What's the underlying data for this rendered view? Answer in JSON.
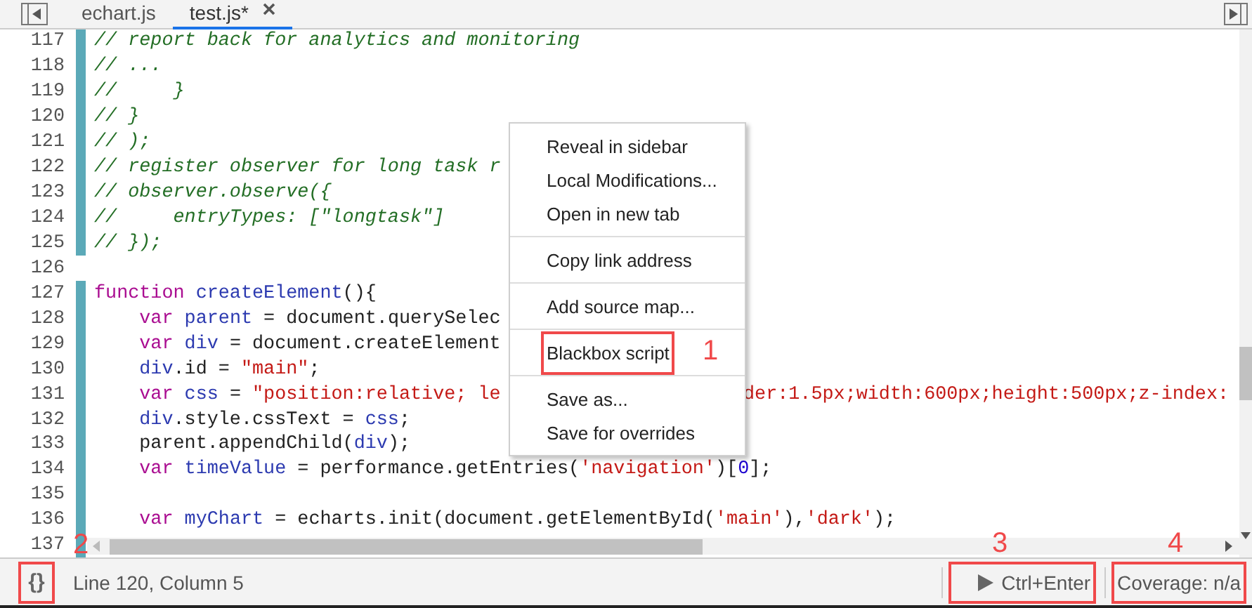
{
  "tabs": [
    {
      "label": "echart.js",
      "selected": false,
      "closable": false
    },
    {
      "label": "test.js*",
      "selected": true,
      "closable": true
    }
  ],
  "editor": {
    "lines": [
      {
        "number": "117",
        "changed": true,
        "tokens": [
          {
            "kind": "comment",
            "text": "// report back for analytics and monitoring"
          }
        ]
      },
      {
        "number": "118",
        "changed": true,
        "tokens": [
          {
            "kind": "comment",
            "text": "// ..."
          }
        ]
      },
      {
        "number": "119",
        "changed": true,
        "tokens": [
          {
            "kind": "comment",
            "text": "//     }"
          }
        ]
      },
      {
        "number": "120",
        "changed": true,
        "tokens": [
          {
            "kind": "comment",
            "text": "// }"
          }
        ]
      },
      {
        "number": "121",
        "changed": true,
        "tokens": [
          {
            "kind": "comment",
            "text": "// );"
          }
        ]
      },
      {
        "number": "122",
        "changed": true,
        "tokens": [
          {
            "kind": "comment",
            "text": "// register observer for long task r"
          }
        ]
      },
      {
        "number": "123",
        "changed": true,
        "tokens": [
          {
            "kind": "comment",
            "text": "// observer.observe({"
          }
        ]
      },
      {
        "number": "124",
        "changed": true,
        "tokens": [
          {
            "kind": "comment",
            "text": "//     entryTypes: [\"longtask\"]"
          }
        ]
      },
      {
        "number": "125",
        "changed": true,
        "tokens": [
          {
            "kind": "comment",
            "text": "// });"
          }
        ]
      },
      {
        "number": "126",
        "changed": false
      },
      {
        "number": "127",
        "changed": true,
        "tokens": [
          {
            "kind": "keyword",
            "text": "function "
          },
          {
            "kind": "def",
            "text": "createElement"
          },
          {
            "kind": "plain",
            "text": "(){"
          }
        ]
      },
      {
        "number": "128",
        "changed": true,
        "tokens": [
          {
            "kind": "keyword",
            "text": "    var "
          },
          {
            "kind": "def",
            "text": "parent"
          },
          {
            "kind": "plain",
            "text": " = document.querySelec"
          }
        ]
      },
      {
        "number": "129",
        "changed": true,
        "tokens": [
          {
            "kind": "keyword",
            "text": "    var "
          },
          {
            "kind": "def",
            "text": "div"
          },
          {
            "kind": "plain",
            "text": " = document.createElement"
          }
        ]
      },
      {
        "number": "130",
        "changed": true,
        "tokens": [
          {
            "kind": "def",
            "text": "    div"
          },
          {
            "kind": "plain",
            "text": ".id = "
          },
          {
            "kind": "string",
            "text": "\"main\""
          },
          {
            "kind": "plain",
            "text": ";"
          }
        ]
      },
      {
        "number": "131",
        "changed": true,
        "tokens": [
          {
            "kind": "keyword",
            "text": "    var "
          },
          {
            "kind": "def",
            "text": "css"
          },
          {
            "kind": "plain",
            "text": " = "
          },
          {
            "kind": "string",
            "text": "\"position:relative; le"
          }
        ],
        "tail": [
          {
            "kind": "string",
            "text": "der:1.5px;width:600px;height:500px;z-index:"
          }
        ]
      },
      {
        "number": "132",
        "changed": true,
        "tokens": [
          {
            "kind": "def",
            "text": "    div"
          },
          {
            "kind": "plain",
            "text": ".style.cssText = "
          },
          {
            "kind": "def",
            "text": "css"
          },
          {
            "kind": "plain",
            "text": ";"
          }
        ]
      },
      {
        "number": "133",
        "changed": true,
        "tokens": [
          {
            "kind": "plain",
            "text": "    parent.appendChild("
          },
          {
            "kind": "def",
            "text": "div"
          },
          {
            "kind": "plain",
            "text": ");"
          }
        ]
      },
      {
        "number": "134",
        "changed": true,
        "tokens": [
          {
            "kind": "keyword",
            "text": "    var "
          },
          {
            "kind": "def",
            "text": "timeValue"
          },
          {
            "kind": "plain",
            "text": " = performance.getEntries("
          },
          {
            "kind": "string",
            "text": "'navigation'"
          },
          {
            "kind": "plain",
            "text": ")["
          },
          {
            "kind": "number",
            "text": "0"
          },
          {
            "kind": "plain",
            "text": "];"
          }
        ]
      },
      {
        "number": "135",
        "changed": true
      },
      {
        "number": "136",
        "changed": true,
        "tokens": [
          {
            "kind": "keyword",
            "text": "    var "
          },
          {
            "kind": "def",
            "text": "myChart"
          },
          {
            "kind": "plain",
            "text": " = echarts.init(document.getElementById("
          },
          {
            "kind": "string",
            "text": "'main'"
          },
          {
            "kind": "plain",
            "text": "),"
          },
          {
            "kind": "string",
            "text": "'dark'"
          },
          {
            "kind": "plain",
            "text": ");"
          }
        ]
      },
      {
        "number": "137",
        "changed": true
      }
    ]
  },
  "context_menu": {
    "items": [
      {
        "label": "Reveal in sidebar",
        "separator_before": false,
        "highlighted": false
      },
      {
        "label": "Local Modifications...",
        "separator_before": false,
        "highlighted": false
      },
      {
        "label": "Open in new tab",
        "separator_before": false,
        "highlighted": false
      },
      {
        "label": "Copy link address",
        "separator_before": true,
        "highlighted": false
      },
      {
        "label": "Add source map...",
        "separator_before": true,
        "highlighted": false
      },
      {
        "label": "Blackbox script",
        "separator_before": true,
        "highlighted": true,
        "note": "1"
      },
      {
        "label": "Save as...",
        "separator_before": true,
        "highlighted": false
      },
      {
        "label": "Save for overrides",
        "separator_before": false,
        "highlighted": false
      }
    ]
  },
  "status_bar": {
    "format_button": {
      "text": "{}",
      "highlighted": true,
      "note": "2"
    },
    "position": "Line 120, Column 5",
    "run_button": {
      "text": "Ctrl+Enter",
      "highlighted": true,
      "note": "3"
    },
    "coverage": {
      "text": "Coverage: n/a",
      "highlighted": true,
      "note": "4"
    }
  }
}
